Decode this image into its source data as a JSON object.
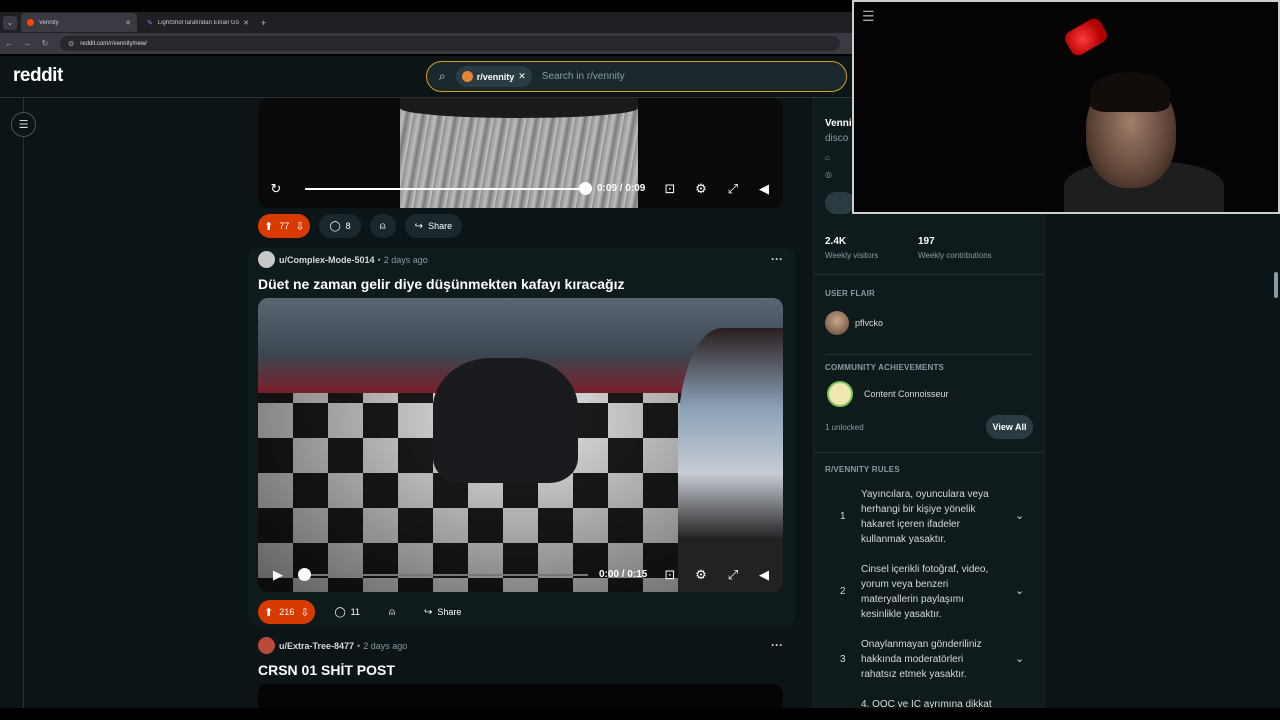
{
  "browser": {
    "tabs": [
      {
        "title": "Vennity",
        "active": true
      },
      {
        "title": "LightShot tarafından Ekran Gö...",
        "active": false
      }
    ],
    "url": "reddit.com/r/vennity/new/"
  },
  "header": {
    "logo": "reddit",
    "search_chip": "r/vennity",
    "search_placeholder": "Search in r/vennity"
  },
  "posts": [
    {
      "time": "0:09 / 0:09",
      "progress": 1.0,
      "votes": "77",
      "comments": "8",
      "share": "Share"
    },
    {
      "user": "u/Complex-Mode-5014",
      "age": "2 days ago",
      "title": "Düet ne zaman gelir diye düşünmekten kafayı kıracağız",
      "time": "0:00 / 0:15",
      "progress": 0.0,
      "votes": "216",
      "comments": "11",
      "share": "Share"
    },
    {
      "user": "u/Extra-Tree-8477",
      "age": "2 days ago",
      "title": "CRSN 01 SHİT POST"
    }
  ],
  "sidebar": {
    "community_name": "Venni",
    "community_sub": "disco",
    "stats": [
      {
        "value": "2.4K",
        "label": "Weekly visitors"
      },
      {
        "value": "197",
        "label": "Weekly contributions"
      }
    ],
    "user_flair_heading": "USER FLAIR",
    "flair_user": "pflvcko",
    "achievements_heading": "COMMUNITY ACHIEVEMENTS",
    "achievement": "Content Connoisseur",
    "unlocked": "1 unlocked",
    "view_all": "View All",
    "rules_heading": "R/VENNITY RULES",
    "rules": [
      {
        "num": "1",
        "text": "Yayıncılara, oyunculara veya herhangi bir kişiye yönelik hakaret içeren ifadeler kullanmak yasaktır."
      },
      {
        "num": "2",
        "text": "Cinsel içerikli fotoğraf, video, yorum veya benzeri materyallerin paylaşımı kesinlikle yasaktır."
      },
      {
        "num": "3",
        "text": "Onaylanmayan gönderiliniz hakkında moderatörleri rahatsız etmek yasaktır."
      },
      {
        "num": "",
        "text": "4. OOC ve IC ayrımına dikkat"
      }
    ]
  },
  "colors": {
    "upvoted": "#d93a00",
    "search_border": "#d4a017",
    "background": "#0b1416"
  }
}
